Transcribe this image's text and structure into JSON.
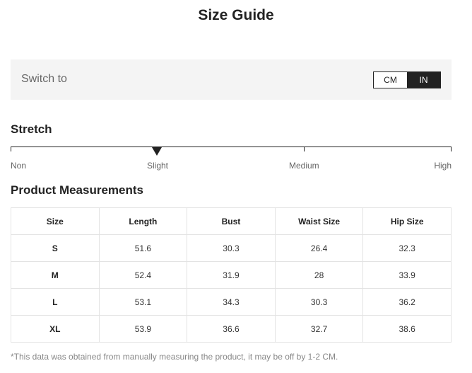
{
  "title": "Size Guide",
  "switch": {
    "label": "Switch to",
    "options": [
      "CM",
      "IN"
    ],
    "selected": "IN"
  },
  "stretch": {
    "heading": "Stretch",
    "levels": [
      "Non",
      "Slight",
      "Medium",
      "High"
    ],
    "current": "Slight"
  },
  "measurements": {
    "heading": "Product Measurements",
    "columns": [
      "Size",
      "Length",
      "Bust",
      "Waist Size",
      "Hip Size"
    ],
    "rows": [
      [
        "S",
        "51.6",
        "30.3",
        "26.4",
        "32.3"
      ],
      [
        "M",
        "52.4",
        "31.9",
        "28",
        "33.9"
      ],
      [
        "L",
        "53.1",
        "34.3",
        "30.3",
        "36.2"
      ],
      [
        "XL",
        "53.9",
        "36.6",
        "32.7",
        "38.6"
      ]
    ]
  },
  "note": "*This data was obtained from manually measuring the product, it may be off by 1-2 CM."
}
